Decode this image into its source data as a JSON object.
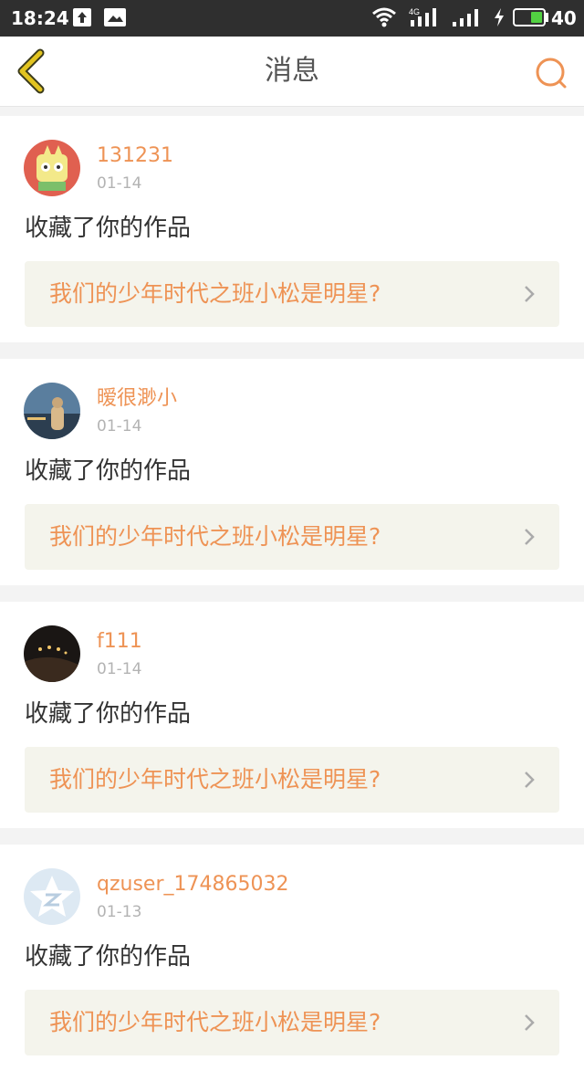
{
  "status_bar": {
    "time": "18:24",
    "network_type": "4G",
    "battery_level": "40",
    "battery_color": "#52d142"
  },
  "header": {
    "title": "消息",
    "back_icon": "chevron-left-icon",
    "search_icon": "search-icon"
  },
  "colors": {
    "accent": "#ee9355",
    "back_arrow": "#e2c420",
    "link_background": "#f4f4ec"
  },
  "messages": [
    {
      "username": "131231",
      "date": "01-14",
      "action": "收藏了你的作品",
      "work_title": "我们的少年时代之班小松是明星?"
    },
    {
      "username": "暧很渺小",
      "date": "01-14",
      "action": "收藏了你的作品",
      "work_title": "我们的少年时代之班小松是明星?"
    },
    {
      "username": "f111",
      "date": "01-14",
      "action": "收藏了你的作品",
      "work_title": "我们的少年时代之班小松是明星?"
    },
    {
      "username": "qzuser_174865032",
      "date": "01-13",
      "action": "收藏了你的作品",
      "work_title": "我们的少年时代之班小松是明星?"
    }
  ]
}
